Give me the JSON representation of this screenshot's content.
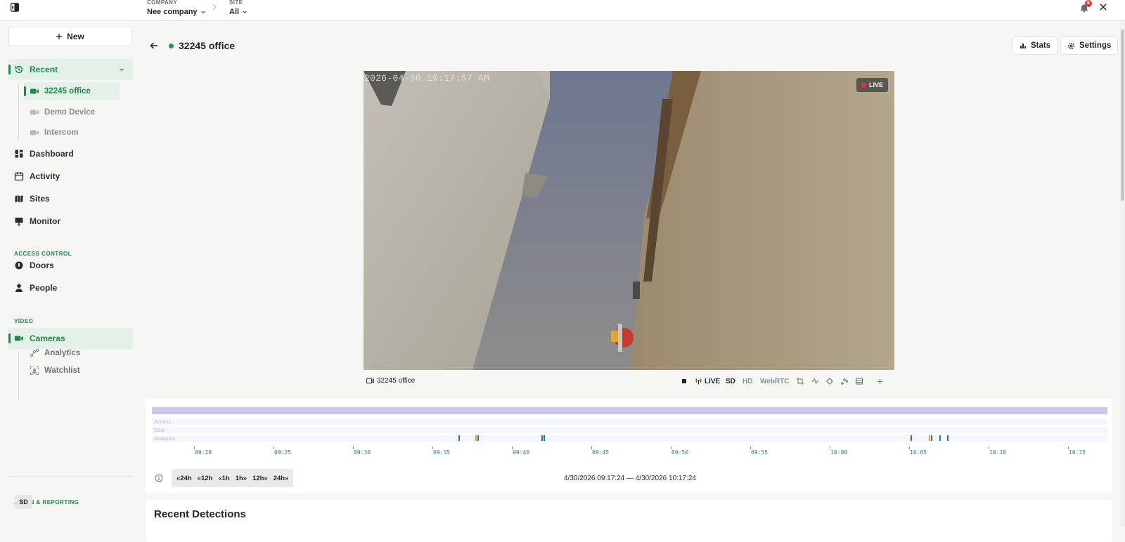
{
  "topbar": {
    "company_label": "COMPANY",
    "company_value": "Nee company",
    "site_label": "SITE",
    "site_value": "All",
    "notification_count": "8"
  },
  "sidebar": {
    "new_label": "New",
    "recent_label": "Recent",
    "recent_items": [
      "32245 office",
      "Demo Device",
      "Intercom"
    ],
    "nav": [
      "Dashboard",
      "Activity",
      "Sites",
      "Monitor"
    ],
    "access_control_label": "ACCESS CONTROL",
    "access_items": [
      "Doors",
      "People"
    ],
    "video_label": "VIDEO",
    "cameras_label": "Cameras",
    "camera_sub_items": [
      "Analytics",
      "Watchlist"
    ],
    "admin_label": "ADMIN & REPORTING",
    "avatar_initials": "SD"
  },
  "header": {
    "title": "32245 office",
    "stats_label": "Stats",
    "settings_label": "Settings"
  },
  "player": {
    "timestamp": "2026-04-30 10:17:57 AM",
    "live_badge": "LIVE",
    "camera_name": "32245 office",
    "live_label": "LIVE",
    "sd_label": "SD",
    "hd_label": "HD",
    "webrtc_label": "WebRTC"
  },
  "timeline": {
    "rows": [
      "Access",
      "Door",
      "Analytics"
    ],
    "ticks": [
      "09:20",
      "09:25",
      "09:30",
      "09:35",
      "09:40",
      "09:45",
      "09:50",
      "09:55",
      "10:00",
      "10:05",
      "10:10",
      "10:15"
    ],
    "range_buttons": [
      "«24h",
      "«12h",
      "«1h",
      "1h»",
      "12h»",
      "24h»"
    ],
    "range_text": "4/30/2026 09:17:24 — 4/30/2026 10:17:24"
  },
  "detections": {
    "title": "Recent Detections"
  },
  "colors": {
    "accent": "#1e8a4a",
    "timeline_bar": "#c9c8f3",
    "event_teal": "#1f7a8c",
    "event_orange": "#e89a3c",
    "live_red": "#e5333a"
  }
}
